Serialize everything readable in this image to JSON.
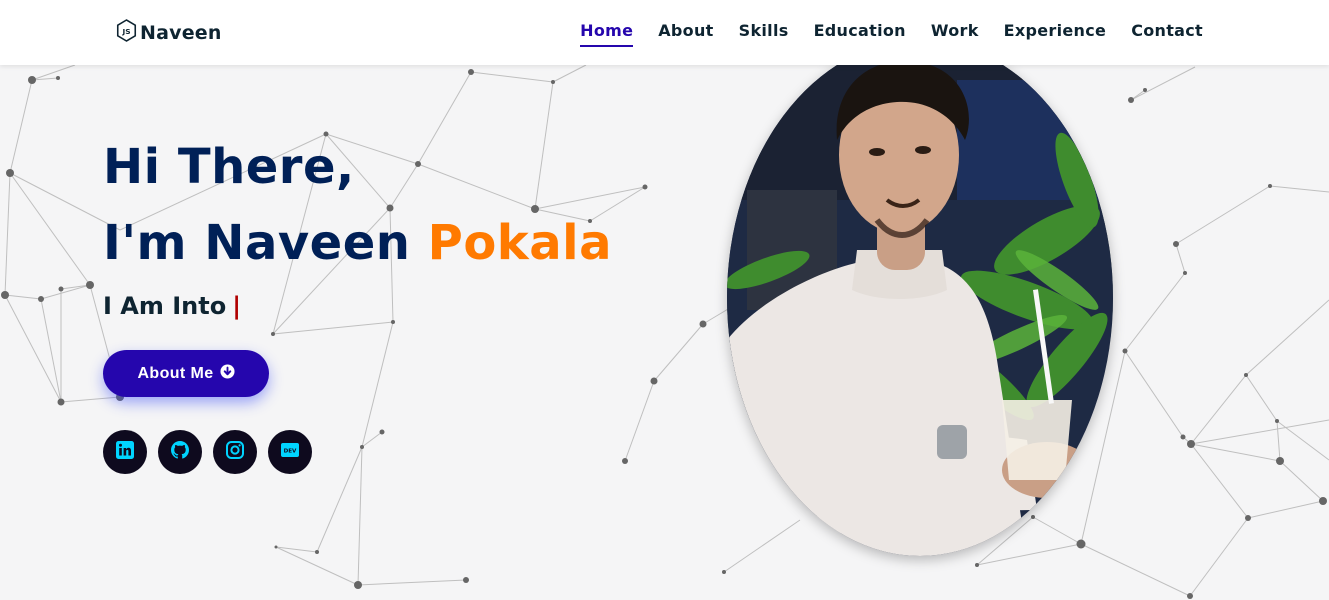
{
  "brand": {
    "name": "Naveen",
    "logo_icon": "js-hexagon-icon"
  },
  "nav": {
    "items": [
      {
        "label": "Home",
        "active": true
      },
      {
        "label": "About",
        "active": false
      },
      {
        "label": "Skills",
        "active": false
      },
      {
        "label": "Education",
        "active": false
      },
      {
        "label": "Work",
        "active": false
      },
      {
        "label": "Experience",
        "active": false
      },
      {
        "label": "Contact",
        "active": false
      }
    ]
  },
  "hero": {
    "greeting": "Hi There,",
    "intro": "I'm Naveen",
    "name_accent": "Pokala",
    "into_text": "I Am Into",
    "cursor": "|",
    "button_label": "About Me",
    "button_icon": "arrow-circle-down-icon"
  },
  "socials": [
    {
      "icon": "linkedin-icon"
    },
    {
      "icon": "github-icon"
    },
    {
      "icon": "instagram-icon"
    },
    {
      "icon": "dev-icon"
    }
  ],
  "colors": {
    "primary": "#2506ad",
    "heading": "#002057",
    "accent": "#ff7a00",
    "social_icon": "#00d4ff",
    "background": "#f5f5f6"
  }
}
